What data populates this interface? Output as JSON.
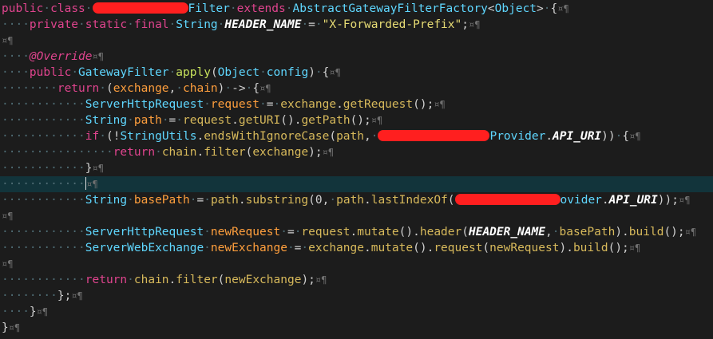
{
  "editor": {
    "colors": {
      "background": "#1c1c1c",
      "current_line": "#12343b",
      "keyword": "#e0448e",
      "type": "#5fd7ff",
      "string": "#e6db74",
      "method": "#c8e25c",
      "variable": "#ff9f3d",
      "redaction": "#ff1f1f",
      "whitespace_marker": "#4e6b73"
    },
    "eol_marker": "¤¶",
    "lines": [
      {
        "indent": "",
        "tokens": [
          [
            "kw",
            "public"
          ],
          [
            "ws",
            "·"
          ],
          [
            "kw",
            "class"
          ],
          [
            "ws",
            "·"
          ],
          [
            "redact",
            ""
          ],
          [
            "ty",
            "Filter"
          ],
          [
            "ws",
            "·"
          ],
          [
            "kw",
            "extends"
          ],
          [
            "ws",
            "·"
          ],
          [
            "ty",
            "AbstractGatewayFilterFactory"
          ],
          [
            "plain",
            "<"
          ],
          [
            "ty",
            "Object"
          ],
          [
            "plain",
            ">"
          ],
          [
            "ws",
            "·"
          ],
          [
            "plain",
            "{"
          ]
        ]
      },
      {
        "indent": "····",
        "tokens": [
          [
            "kw",
            "private"
          ],
          [
            "ws",
            "·"
          ],
          [
            "kw",
            "static"
          ],
          [
            "ws",
            "·"
          ],
          [
            "kw",
            "final"
          ],
          [
            "ws",
            "·"
          ],
          [
            "ty",
            "String"
          ],
          [
            "ws",
            "·"
          ],
          [
            "fld",
            "HEADER_NAME"
          ],
          [
            "ws",
            "·"
          ],
          [
            "plain",
            "="
          ],
          [
            "ws",
            "·"
          ],
          [
            "str",
            "\"X-Forwarded-Prefix\""
          ],
          [
            "plain",
            ";"
          ]
        ]
      },
      {
        "indent": "",
        "tokens": []
      },
      {
        "indent": "····",
        "tokens": [
          [
            "ann",
            "@Override"
          ]
        ]
      },
      {
        "indent": "····",
        "tokens": [
          [
            "kw",
            "public"
          ],
          [
            "ws",
            "·"
          ],
          [
            "ty",
            "GatewayFilter"
          ],
          [
            "ws",
            "·"
          ],
          [
            "meth",
            "apply"
          ],
          [
            "plain",
            "("
          ],
          [
            "ty",
            "Object"
          ],
          [
            "ws",
            "·"
          ],
          [
            "ty",
            "config"
          ],
          [
            "plain",
            ")"
          ],
          [
            "ws",
            "·"
          ],
          [
            "plain",
            "{"
          ]
        ]
      },
      {
        "indent": "········",
        "tokens": [
          [
            "kw",
            "return"
          ],
          [
            "ws",
            "·"
          ],
          [
            "plain",
            "("
          ],
          [
            "param",
            "exchange"
          ],
          [
            "plain",
            ","
          ],
          [
            "ws",
            "·"
          ],
          [
            "param",
            "chain"
          ],
          [
            "plain",
            ")"
          ],
          [
            "ws",
            "·"
          ],
          [
            "plain",
            "->"
          ],
          [
            "ws",
            "·"
          ],
          [
            "plain",
            "{"
          ]
        ]
      },
      {
        "indent": "············",
        "tokens": [
          [
            "ty",
            "ServerHttpRequest"
          ],
          [
            "ws",
            "·"
          ],
          [
            "var",
            "request"
          ],
          [
            "ws",
            "·"
          ],
          [
            "plain",
            "="
          ],
          [
            "ws",
            "·"
          ],
          [
            "call",
            "exchange"
          ],
          [
            "plain",
            "."
          ],
          [
            "call",
            "getRequest"
          ],
          [
            "plain",
            "();"
          ]
        ]
      },
      {
        "indent": "············",
        "tokens": [
          [
            "ty",
            "String"
          ],
          [
            "ws",
            "·"
          ],
          [
            "var",
            "path"
          ],
          [
            "ws",
            "·"
          ],
          [
            "plain",
            "="
          ],
          [
            "ws",
            "·"
          ],
          [
            "call",
            "request"
          ],
          [
            "plain",
            "."
          ],
          [
            "call",
            "getURI"
          ],
          [
            "plain",
            "()."
          ],
          [
            "call",
            "getPath"
          ],
          [
            "plain",
            "();"
          ]
        ]
      },
      {
        "indent": "············",
        "tokens": [
          [
            "kw",
            "if"
          ],
          [
            "ws",
            "·"
          ],
          [
            "plain",
            "(!"
          ],
          [
            "ty",
            "StringUtils"
          ],
          [
            "plain",
            "."
          ],
          [
            "call",
            "endsWithIgnoreCase"
          ],
          [
            "plain",
            "("
          ],
          [
            "call",
            "path"
          ],
          [
            "plain",
            ","
          ],
          [
            "ws",
            "·"
          ],
          [
            "redact",
            ""
          ],
          [
            "ty",
            "Provider"
          ],
          [
            "plain",
            "."
          ],
          [
            "const",
            "API_URI"
          ],
          [
            "plain",
            "))"
          ],
          [
            "ws",
            "·"
          ],
          [
            "plain",
            "{"
          ]
        ]
      },
      {
        "indent": "················",
        "tokens": [
          [
            "kw",
            "return"
          ],
          [
            "ws",
            "·"
          ],
          [
            "call",
            "chain"
          ],
          [
            "plain",
            "."
          ],
          [
            "call",
            "filter"
          ],
          [
            "plain",
            "("
          ],
          [
            "call",
            "exchange"
          ],
          [
            "plain",
            ");"
          ]
        ]
      },
      {
        "indent": "············",
        "tokens": [
          [
            "plain",
            "}"
          ]
        ]
      },
      {
        "indent": "············",
        "tokens": [
          [
            "cursor",
            ""
          ]
        ],
        "current": true
      },
      {
        "indent": "············",
        "tokens": [
          [
            "ty",
            "String"
          ],
          [
            "ws",
            "·"
          ],
          [
            "var",
            "basePath"
          ],
          [
            "ws",
            "·"
          ],
          [
            "plain",
            "="
          ],
          [
            "ws",
            "·"
          ],
          [
            "call",
            "path"
          ],
          [
            "plain",
            "."
          ],
          [
            "call",
            "substring"
          ],
          [
            "plain",
            "("
          ],
          [
            "num",
            "0"
          ],
          [
            "plain",
            ","
          ],
          [
            "ws",
            "·"
          ],
          [
            "call",
            "path"
          ],
          [
            "plain",
            "."
          ],
          [
            "call",
            "lastIndexOf"
          ],
          [
            "plain",
            "("
          ],
          [
            "redact",
            ""
          ],
          [
            "ty",
            "ovider"
          ],
          [
            "plain",
            "."
          ],
          [
            "const",
            "API_URI"
          ],
          [
            "plain",
            "));"
          ]
        ]
      },
      {
        "indent": "",
        "tokens": []
      },
      {
        "indent": "············",
        "tokens": [
          [
            "ty",
            "ServerHttpRequest"
          ],
          [
            "ws",
            "·"
          ],
          [
            "var",
            "newRequest"
          ],
          [
            "ws",
            "·"
          ],
          [
            "plain",
            "="
          ],
          [
            "ws",
            "·"
          ],
          [
            "call",
            "request"
          ],
          [
            "plain",
            "."
          ],
          [
            "call",
            "mutate"
          ],
          [
            "plain",
            "()."
          ],
          [
            "call",
            "header"
          ],
          [
            "plain",
            "("
          ],
          [
            "const",
            "HEADER_NAME"
          ],
          [
            "plain",
            ","
          ],
          [
            "ws",
            "·"
          ],
          [
            "call",
            "basePath"
          ],
          [
            "plain",
            ")."
          ],
          [
            "call",
            "build"
          ],
          [
            "plain",
            "();"
          ]
        ]
      },
      {
        "indent": "············",
        "tokens": [
          [
            "ty",
            "ServerWebExchange"
          ],
          [
            "ws",
            "·"
          ],
          [
            "var",
            "newExchange"
          ],
          [
            "ws",
            "·"
          ],
          [
            "plain",
            "="
          ],
          [
            "ws",
            "·"
          ],
          [
            "call",
            "exchange"
          ],
          [
            "plain",
            "."
          ],
          [
            "call",
            "mutate"
          ],
          [
            "plain",
            "()."
          ],
          [
            "call",
            "request"
          ],
          [
            "plain",
            "("
          ],
          [
            "call",
            "newRequest"
          ],
          [
            "plain",
            ")."
          ],
          [
            "call",
            "build"
          ],
          [
            "plain",
            "();"
          ]
        ]
      },
      {
        "indent": "",
        "tokens": []
      },
      {
        "indent": "············",
        "tokens": [
          [
            "kw",
            "return"
          ],
          [
            "ws",
            "·"
          ],
          [
            "call",
            "chain"
          ],
          [
            "plain",
            "."
          ],
          [
            "call",
            "filter"
          ],
          [
            "plain",
            "("
          ],
          [
            "call",
            "newExchange"
          ],
          [
            "plain",
            ");"
          ]
        ]
      },
      {
        "indent": "········",
        "tokens": [
          [
            "plain",
            "};"
          ]
        ]
      },
      {
        "indent": "····",
        "tokens": [
          [
            "plain",
            "}"
          ]
        ]
      },
      {
        "indent": "",
        "tokens": [
          [
            "plain",
            "}"
          ]
        ]
      }
    ]
  }
}
